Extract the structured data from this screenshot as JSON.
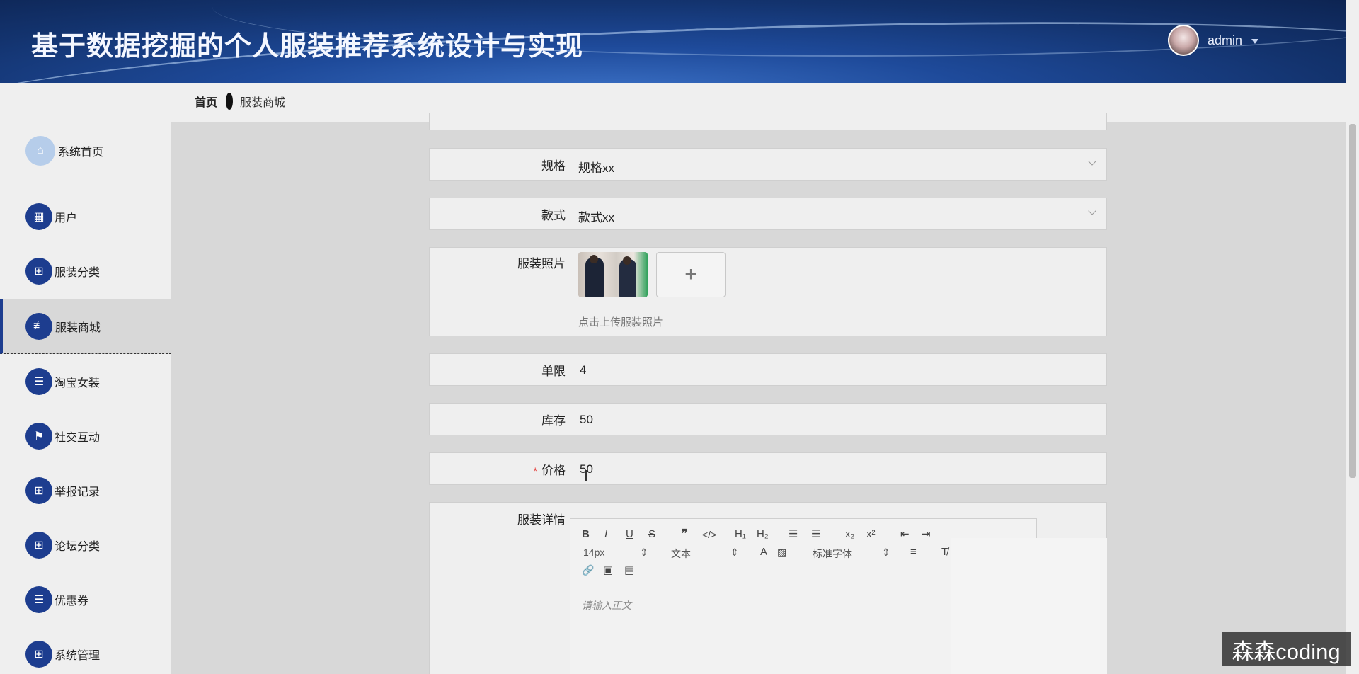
{
  "header": {
    "title": "基于数据挖掘的个人服装推荐系统设计与实现",
    "user": "admin"
  },
  "breadcrumb": {
    "home": "首页",
    "current": "服装商城"
  },
  "sidebar": {
    "items": [
      {
        "label": "系统首页",
        "icon": "home-icon"
      },
      {
        "label": "用户",
        "icon": "grid-icon"
      },
      {
        "label": "服装分类",
        "icon": "grid-icon"
      },
      {
        "label": "服装商城",
        "icon": "sliders-icon",
        "active": true
      },
      {
        "label": "淘宝女装",
        "icon": "list-icon"
      },
      {
        "label": "社交互动",
        "icon": "flag-icon"
      },
      {
        "label": "举报记录",
        "icon": "grid-icon"
      },
      {
        "label": "论坛分类",
        "icon": "grid-icon"
      },
      {
        "label": "优惠券",
        "icon": "list-icon"
      },
      {
        "label": "系统管理",
        "icon": "grid-icon"
      }
    ]
  },
  "form": {
    "spec": {
      "label": "规格",
      "value": "规格xx"
    },
    "style": {
      "label": "款式",
      "value": "款式xx"
    },
    "photo": {
      "label": "服装照片",
      "hint": "点击上传服装照片",
      "add": "+"
    },
    "limit": {
      "label": "单限",
      "value": "4"
    },
    "stock": {
      "label": "库存",
      "value": "50"
    },
    "price": {
      "label": "价格",
      "value": "50",
      "required": "*"
    },
    "detail": {
      "label": "服装详情",
      "placeholder": "请输入正文",
      "toolbar": {
        "bold": "B",
        "italic": "I",
        "underline": "U",
        "strike": "S",
        "quote": "❞",
        "code": "</>",
        "h1": "H₁",
        "h2": "H₂",
        "ol": "☰",
        "ul": "☰",
        "sub": "x₂",
        "sup": "x²",
        "outdent": "⇤",
        "indent": "⇥",
        "size": "14px",
        "header": "文本",
        "color": "A",
        "bg": "▨",
        "font": "标准字体",
        "align": "≡",
        "clean": "T̸",
        "link": "🔗",
        "image": "▣",
        "video": "▤"
      }
    }
  },
  "watermark": "森森coding",
  "colors": {
    "accent": "#1d3d8f",
    "header": "#13336e",
    "required": "#e53935"
  }
}
